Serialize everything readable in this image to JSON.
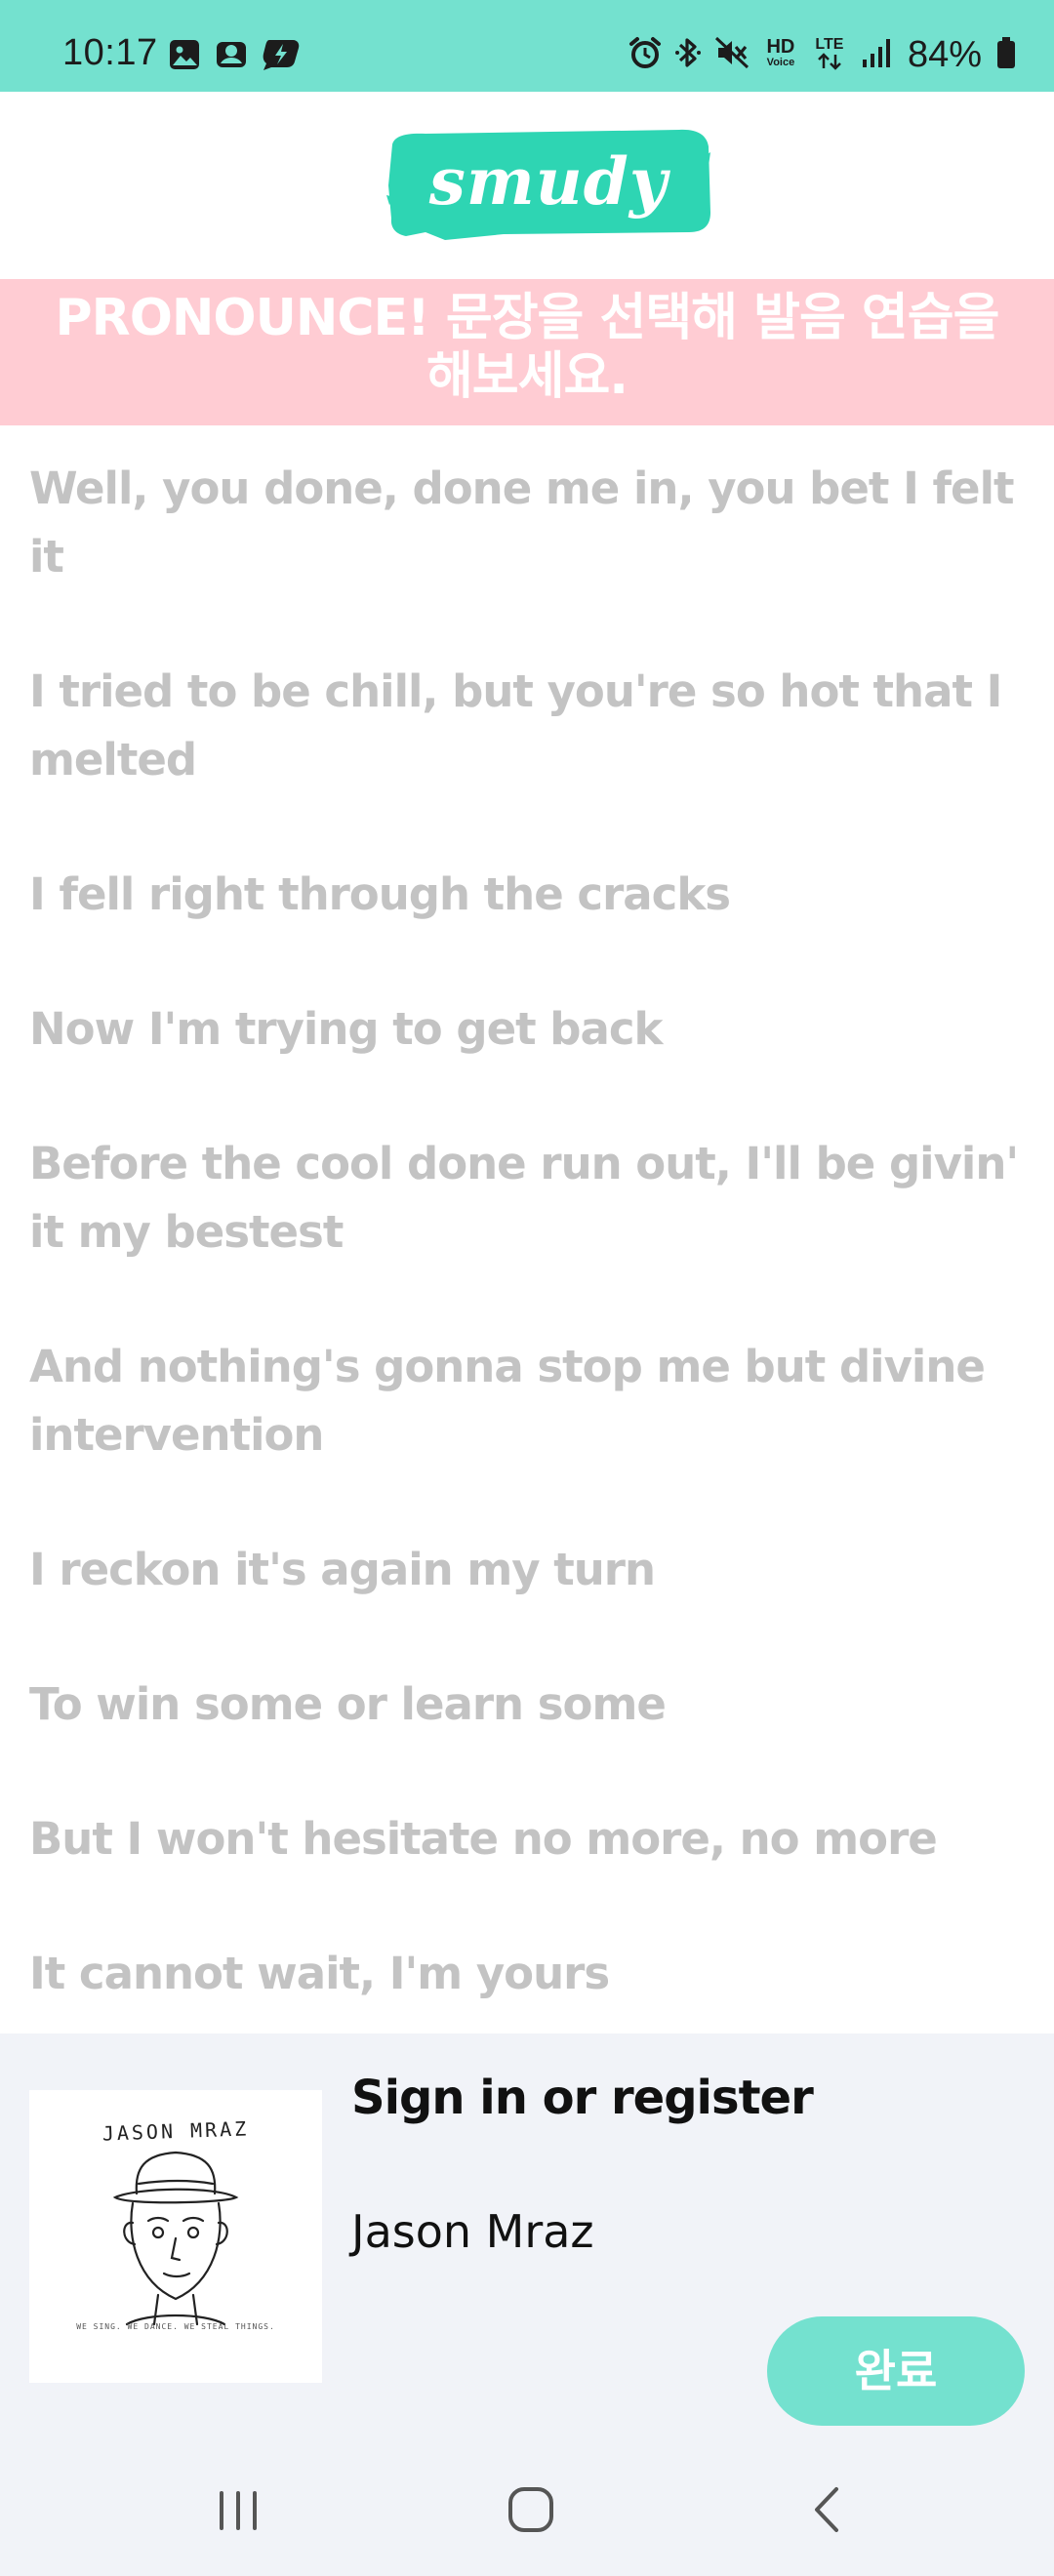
{
  "status_bar": {
    "time": "10:17",
    "battery_percent": "84%",
    "network_label": "LTE",
    "hd_label": "HD",
    "voice_label": "Voice",
    "left_icons": [
      "image-icon",
      "cloud-app-icon",
      "chat-bubble-icon"
    ],
    "right_icons": [
      "alarm-icon",
      "bluetooth-icon",
      "mute-icon",
      "hd-voice-icon",
      "lte-icon",
      "signal-icon",
      "battery-icon"
    ]
  },
  "header": {
    "logo_text": "smudy",
    "logo_color": "#2ed5b3"
  },
  "banner": {
    "text": "PRONOUNCE! 문장을 선택해 발음 연습을 해보세요.",
    "color": "#ffccd3"
  },
  "lyrics": [
    "Well, you done, done me in, you bet I felt it",
    "I tried to be chill, but you're so hot that I melted",
    "I fell right through the cracks",
    "Now I'm trying to get back",
    "Before the cool done run out, I'll be givin' it my bestest",
    "And nothing's gonna stop me but divine intervention",
    "I reckon it's again my turn",
    "To win some or learn some",
    "But I won't hesitate no more, no more",
    "It cannot wait, I'm yours"
  ],
  "song": {
    "title": "Sign in or register",
    "artist": "Jason Mraz",
    "album_art_artist": "JASON MRAZ",
    "album_art_caption": "WE SING. WE DANCE. WE STEAL THINGS."
  },
  "actions": {
    "done_label": "완료"
  },
  "colors": {
    "accent": "#74e1cf",
    "lyric_text": "#c3c3c3",
    "panel_bg": "#f1f3f8"
  },
  "nav_bar": {
    "buttons": [
      "recent-apps-icon",
      "home-icon",
      "back-icon"
    ]
  }
}
